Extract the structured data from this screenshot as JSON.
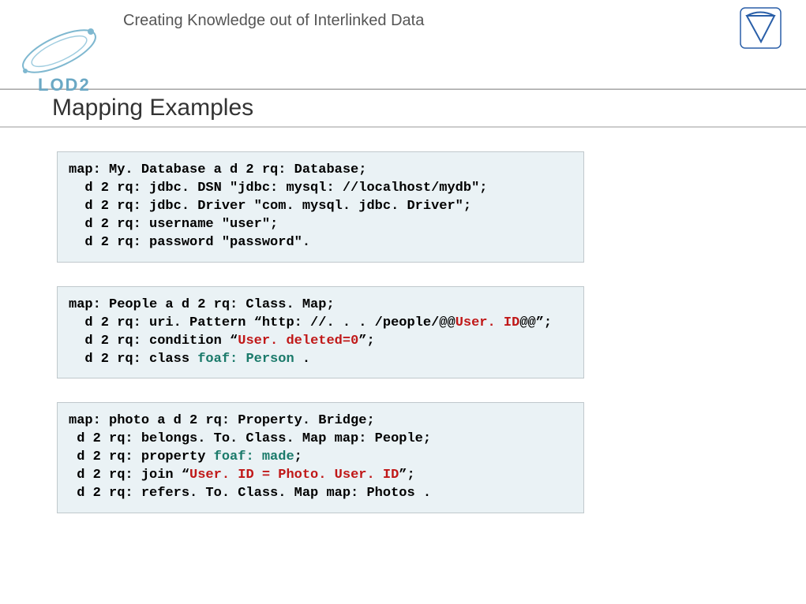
{
  "header": {
    "tagline": "Creating Knowledge out of Interlinked Data",
    "logo_text": "LOD2"
  },
  "title": "Mapping Examples",
  "block1": {
    "l1_a": "map: My. Database a d 2 rq: Database;",
    "l2_a": "  d 2 rq: jdbc. DSN \"jdbc: mysql: //localhost/mydb\";",
    "l3_a": "  d 2 rq: jdbc. Driver \"com. mysql. jdbc. Driver\";",
    "l4_a": "  d 2 rq: username \"user\";",
    "l5_a": "  d 2 rq: password \"password\"."
  },
  "block2": {
    "l1_a": "map: People a d 2 rq: Class. Map;",
    "l2_a": "  d 2 rq: uri. Pattern “http: //. . . /people/@@",
    "l2_b": "User. ID",
    "l2_c": "@@”;",
    "l3_a": "  d 2 rq: condition “",
    "l3_b": "User. deleted=0",
    "l3_c": "”;",
    "l4_a": "  d 2 rq: class ",
    "l4_b": "foaf: Person",
    "l4_c": " ."
  },
  "block3": {
    "l1_a": "map: photo a d 2 rq: Property. Bridge;",
    "l2_a": " d 2 rq: belongs. To. Class. Map map: People;",
    "l3_a": " d 2 rq: property ",
    "l3_b": "foaf: made",
    "l3_c": ";",
    "l4_a": " d 2 rq: join “",
    "l4_b": "User. ID = Photo. User. ID",
    "l4_c": "”;",
    "l5_a": " d 2 rq: refers. To. Class. Map map: Photos ."
  }
}
